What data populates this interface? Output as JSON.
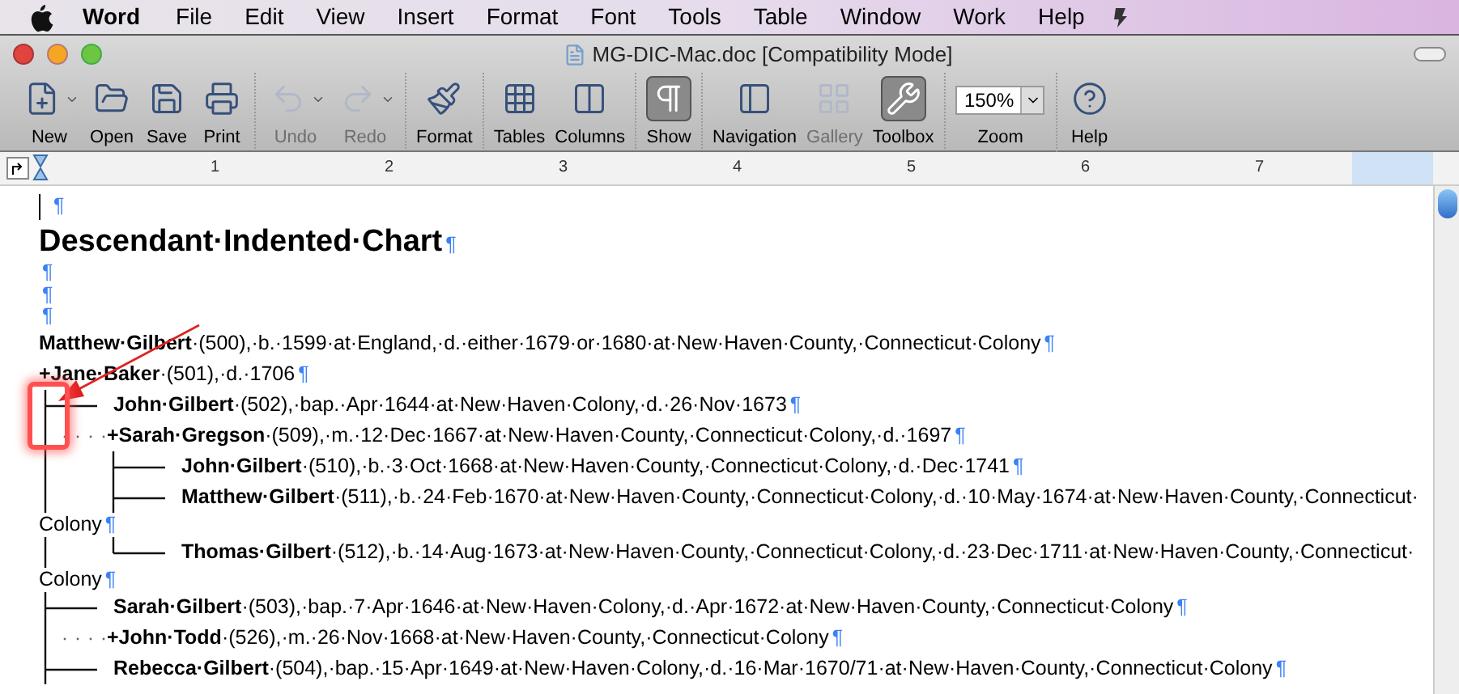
{
  "menu_bar": {
    "app": "Word",
    "items": [
      "File",
      "Edit",
      "View",
      "Insert",
      "Format",
      "Font",
      "Tools",
      "Table",
      "Window",
      "Work",
      "Help"
    ]
  },
  "window": {
    "title": "MG-DIC-Mac.doc [Compatibility Mode]"
  },
  "toolbar": {
    "groups": [
      [
        {
          "kind": "button",
          "label": "New",
          "disabled": false,
          "selected": false,
          "menu": true
        },
        {
          "kind": "button",
          "label": "Open",
          "disabled": false,
          "selected": false,
          "menu": false
        },
        {
          "kind": "button",
          "label": "Save",
          "disabled": false,
          "selected": false,
          "menu": false
        },
        {
          "kind": "button",
          "label": "Print",
          "disabled": false,
          "selected": false,
          "menu": false
        }
      ],
      [
        {
          "kind": "button",
          "label": "Undo",
          "disabled": true,
          "selected": false,
          "menu": true
        },
        {
          "kind": "button",
          "label": "Redo",
          "disabled": true,
          "selected": false,
          "menu": true
        }
      ],
      [
        {
          "kind": "button",
          "label": "Format",
          "disabled": false,
          "selected": false,
          "menu": false
        }
      ],
      [
        {
          "kind": "button",
          "label": "Tables",
          "disabled": false,
          "selected": false,
          "menu": false
        },
        {
          "kind": "button",
          "label": "Columns",
          "disabled": false,
          "selected": false,
          "menu": false
        }
      ],
      [
        {
          "kind": "button",
          "label": "Show",
          "disabled": false,
          "selected": true,
          "menu": false
        }
      ],
      [
        {
          "kind": "button",
          "label": "Navigation",
          "disabled": false,
          "selected": false,
          "menu": false
        },
        {
          "kind": "button",
          "label": "Gallery",
          "disabled": true,
          "selected": false,
          "menu": false
        },
        {
          "kind": "button",
          "label": "Toolbox",
          "disabled": false,
          "selected": true,
          "menu": false
        }
      ],
      [
        {
          "kind": "zoom",
          "label": "Zoom",
          "value": "150%"
        }
      ],
      [
        {
          "kind": "button",
          "label": "Help",
          "disabled": false,
          "selected": false,
          "menu": false
        }
      ]
    ]
  },
  "ruler": {
    "numbers": [
      "1",
      "2",
      "3",
      "4",
      "5",
      "6",
      "7"
    ]
  },
  "document": {
    "cursor_mark": "¶",
    "title": "Descendant·Indented·Chart",
    "title_mark": "¶",
    "blank_marks": [
      "¶",
      "¶",
      "¶"
    ],
    "tree": [
      {
        "text": "**Matthew·Gilbert**·(500),·b.·1599·at·England,·d.·either·1679·or·1680·at·New·Haven·County,·Connecticut·Colony",
        "mark": "¶",
        "spouse": {
          "text": "**+Jane·Baker**·(501),·d.·1706",
          "mark": "¶"
        },
        "children": [
          {
            "text": "**John·Gilbert**·(502),·bap.·Apr·1644·at·New·Haven·Colony,·d.·26·Nov·1673",
            "mark": "¶",
            "spouse": {
              "text": "**+Sarah·Gregson**·(509),·m.·12·Dec·1667·at·New·Haven·County,·Connecticut·Colony,·d.·1697",
              "mark": "¶"
            },
            "children": [
              {
                "text": "**John·Gilbert**·(510),·b.·3·Oct·1668·at·New·Haven·County,·Connecticut·Colony,·d.·Dec·1741",
                "mark": "¶"
              },
              {
                "text": "**Matthew·Gilbert**·(511),·b.·24·Feb·1670·at·New·Haven·County,·Connecticut·Colony,·d.·10·May·1674·at·New·Haven·County,·Connecticut·",
                "continuation": "Colony",
                "mark": "¶"
              },
              {
                "text": "**Thomas·Gilbert**·(512),·b.·14·Aug·1673·at·New·Haven·County,·Connecticut·Colony,·d.·23·Dec·1711·at·New·Haven·County,·Connecticut·",
                "continuation": "Colony",
                "mark": "¶"
              }
            ]
          },
          {
            "text": "**Sarah·Gilbert**·(503),·bap.·7·Apr·1646·at·New·Haven·Colony,·d.·Apr·1672·at·New·Haven·County,·Connecticut·Colony",
            "mark": "¶",
            "spouse": {
              "text": "**+John·Todd**·(526),·m.·26·Nov·1668·at·New·Haven·County,·Connecticut·Colony",
              "mark": "¶"
            }
          },
          {
            "text": "**Rebecca·Gilbert**·(504),·bap.·15·Apr·1649·at·New·Haven·Colony,·d.·16·Mar·1670/71·at·New·Haven·County,·Connecticut·Colony",
            "mark": "¶"
          }
        ]
      }
    ]
  }
}
